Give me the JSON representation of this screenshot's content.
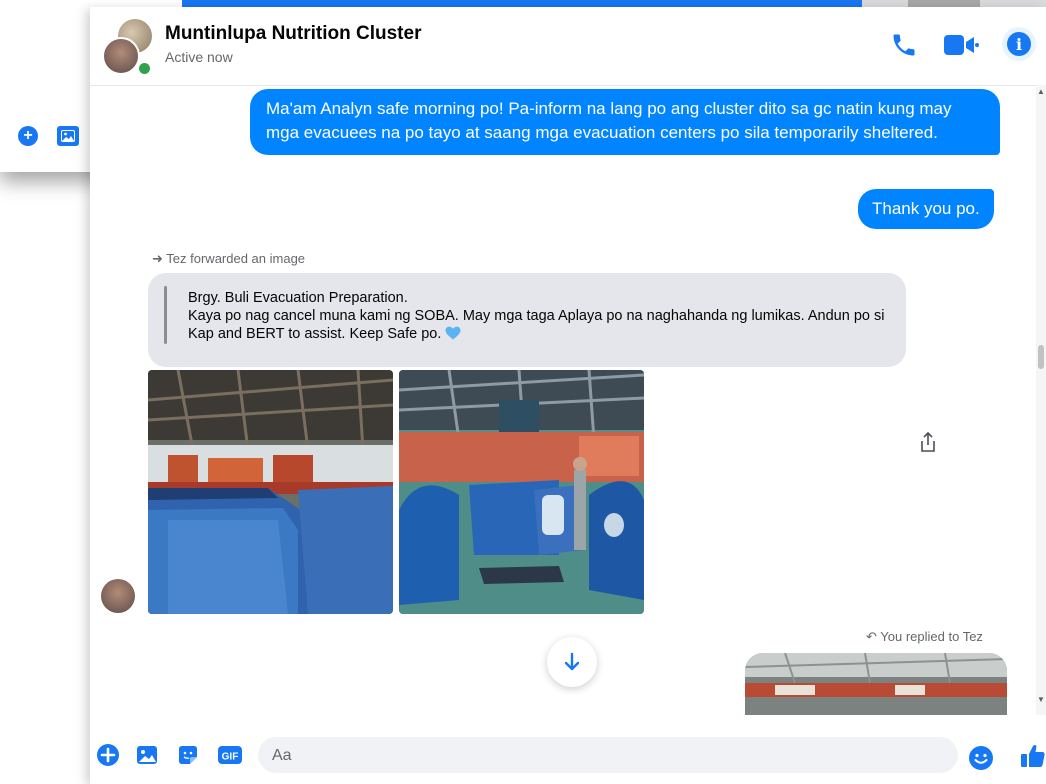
{
  "chat": {
    "title": "Muntinlupa Nutrition Cluster",
    "status": "Active now"
  },
  "messages": {
    "outgoing_1": "Ma'am Analyn safe morning po! Pa-inform na lang po ang cluster dito sa gc natin kung may mga evacuees na po tayo at saang mga evacuation centers po sila temporarily sheltered.",
    "outgoing_2": "Thank you po.",
    "forward_note": "Tez forwarded an image",
    "forwarded_line1": "Brgy. Buli Evacuation Preparation.",
    "forwarded_line2": "Kaya po nag cancel muna kami ng SOBA. May mga taga Aplaya po na naghahanda ng lumikas. Andun po si Kap and BERT to assist. Keep Safe po.",
    "reply_note": "You replied to Tez"
  },
  "composer": {
    "placeholder": "Aa",
    "gif_label": "GIF"
  },
  "icons": {
    "header": [
      "phone-icon",
      "video-camera-icon",
      "info-icon"
    ],
    "composer": [
      "plus-icon",
      "image-icon",
      "sticker-icon",
      "gif-icon",
      "emoji-icon",
      "like-icon"
    ]
  },
  "colors": {
    "accent": "#1877f2",
    "bubble": "#0084ff",
    "incoming": "#e4e6eb",
    "online": "#31a24c"
  }
}
